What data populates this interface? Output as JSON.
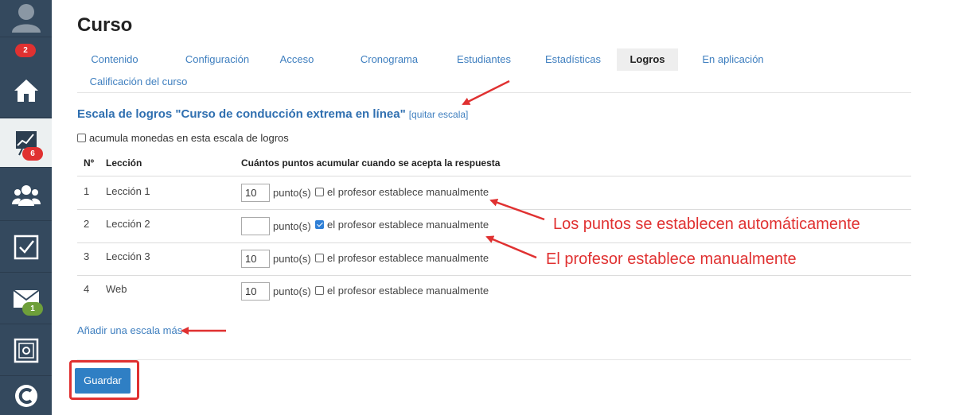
{
  "sidebar": {
    "badges": {
      "home_count": "2",
      "reports_count": "6",
      "mail_count": "1"
    },
    "icons": [
      "user-avatar-icon",
      "home-icon",
      "chart-icon",
      "users-icon",
      "checklist-icon",
      "mail-icon",
      "safe-icon",
      "logo-icon"
    ]
  },
  "page": {
    "title": "Curso"
  },
  "tabs": [
    {
      "label": "Contenido",
      "active": false
    },
    {
      "label": "Configuración",
      "active": false
    },
    {
      "label": "Acceso",
      "active": false
    },
    {
      "label": "Cronograma",
      "active": false
    },
    {
      "label": "Estudiantes",
      "active": false
    },
    {
      "label": "Estadísticas",
      "active": false
    },
    {
      "label": "Logros",
      "active": true
    },
    {
      "label": "En aplicación",
      "active": false
    },
    {
      "label": "Calificación del curso",
      "active": false
    }
  ],
  "scale": {
    "heading": "Escala de logros \"Curso de conducción extrema en línea\"",
    "remove_link": "[quitar escala]",
    "accumulate_label": "acumula monedas en esta escala de logros",
    "accumulate_checked": false
  },
  "table": {
    "headers": {
      "num": "Nº",
      "lesson": "Lección",
      "points": "Cuántos puntos acumular cuando se acepta la respuesta"
    },
    "unit_label": "punto(s)",
    "manual_label": "el profesor establece manualmente",
    "rows": [
      {
        "num": "1",
        "lesson": "Lección 1",
        "points": "10",
        "manual": false
      },
      {
        "num": "2",
        "lesson": "Lección 2",
        "points": "",
        "manual": true
      },
      {
        "num": "3",
        "lesson": "Lección 3",
        "points": "10",
        "manual": false
      },
      {
        "num": "4",
        "lesson": "Web",
        "points": "10",
        "manual": false
      }
    ]
  },
  "add_scale_link": "Añadir una escala más",
  "save_label": "Guardar",
  "annotations": {
    "auto_points": "Los puntos se establecen automáticamente",
    "manual_points": "El profesor establece manualmente"
  },
  "colors": {
    "sidebar": "#34495e",
    "link": "#3f7fbf",
    "accent_button": "#2f7fc4",
    "annotation": "#e03131"
  }
}
